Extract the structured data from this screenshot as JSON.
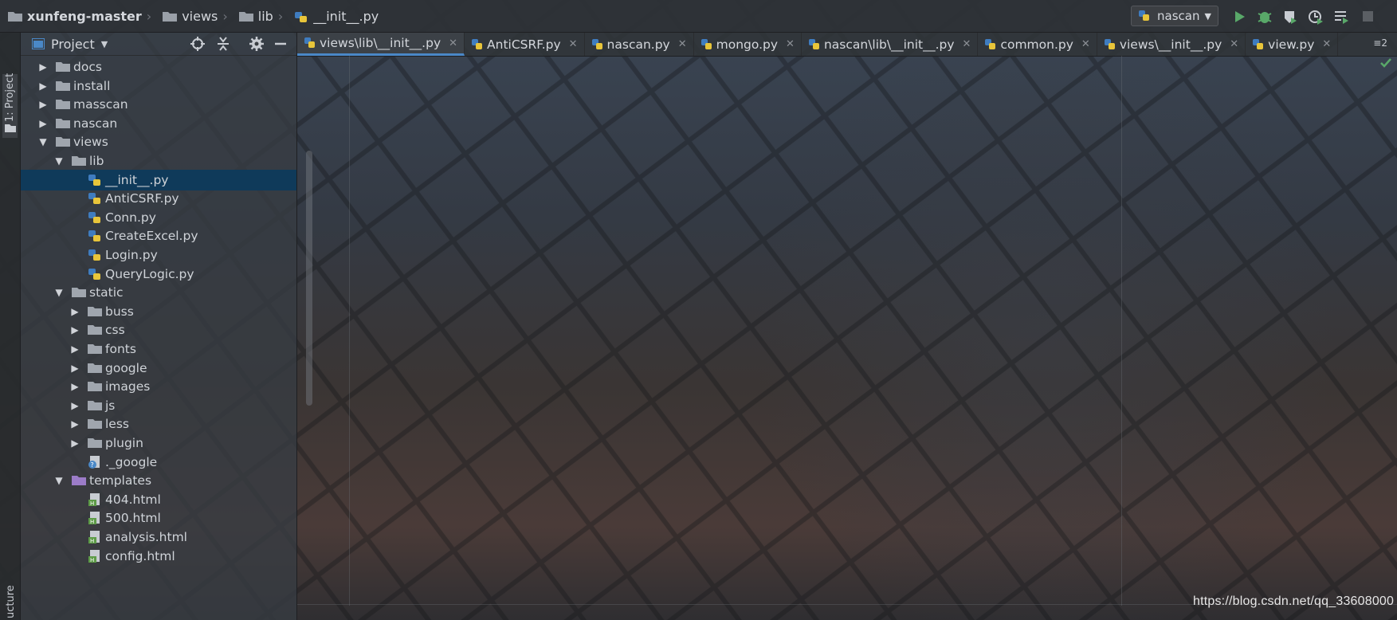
{
  "breadcrumb": {
    "items": [
      "xunfeng-master",
      "views",
      "lib",
      "__init__.py"
    ]
  },
  "run_config": {
    "label": "nascan"
  },
  "toolbar_icons": [
    "run-icon",
    "debug-icon",
    "coverage-icon",
    "profile-icon",
    "run-list-icon",
    "stop-icon"
  ],
  "left_strip": {
    "project_tab": "1: Project",
    "structure_tab": "ucture"
  },
  "project_panel": {
    "title": "Project",
    "tree": [
      {
        "label": "docs",
        "depth": 0,
        "type": "folder",
        "expanded": false
      },
      {
        "label": "install",
        "depth": 0,
        "type": "folder",
        "expanded": false
      },
      {
        "label": "masscan",
        "depth": 0,
        "type": "folder",
        "expanded": false
      },
      {
        "label": "nascan",
        "depth": 0,
        "type": "folder",
        "expanded": false
      },
      {
        "label": "views",
        "depth": 0,
        "type": "folder",
        "expanded": true
      },
      {
        "label": "lib",
        "depth": 1,
        "type": "folder",
        "expanded": true
      },
      {
        "label": "__init__.py",
        "depth": 2,
        "type": "python",
        "selected": true
      },
      {
        "label": "AntiCSRF.py",
        "depth": 2,
        "type": "python"
      },
      {
        "label": "Conn.py",
        "depth": 2,
        "type": "python"
      },
      {
        "label": "CreateExcel.py",
        "depth": 2,
        "type": "python"
      },
      {
        "label": "Login.py",
        "depth": 2,
        "type": "python"
      },
      {
        "label": "QueryLogic.py",
        "depth": 2,
        "type": "python"
      },
      {
        "label": "static",
        "depth": 1,
        "type": "folder",
        "expanded": true
      },
      {
        "label": "buss",
        "depth": 2,
        "type": "folder",
        "expanded": false
      },
      {
        "label": "css",
        "depth": 2,
        "type": "folder",
        "expanded": false
      },
      {
        "label": "fonts",
        "depth": 2,
        "type": "folder",
        "expanded": false
      },
      {
        "label": "google",
        "depth": 2,
        "type": "folder",
        "expanded": false
      },
      {
        "label": "images",
        "depth": 2,
        "type": "folder",
        "expanded": false
      },
      {
        "label": "js",
        "depth": 2,
        "type": "folder",
        "expanded": false
      },
      {
        "label": "less",
        "depth": 2,
        "type": "folder",
        "expanded": false
      },
      {
        "label": "plugin",
        "depth": 2,
        "type": "folder",
        "expanded": false
      },
      {
        "label": "._google",
        "depth": 2,
        "type": "unknown"
      },
      {
        "label": "templates",
        "depth": 1,
        "type": "template-folder",
        "expanded": true
      },
      {
        "label": "404.html",
        "depth": 2,
        "type": "html"
      },
      {
        "label": "500.html",
        "depth": 2,
        "type": "html"
      },
      {
        "label": "analysis.html",
        "depth": 2,
        "type": "html"
      },
      {
        "label": "config.html",
        "depth": 2,
        "type": "html"
      }
    ]
  },
  "editor_tabs": [
    {
      "label": "views\\lib\\__init__.py",
      "active": true
    },
    {
      "label": "AntiCSRF.py"
    },
    {
      "label": "nascan.py"
    },
    {
      "label": "mongo.py"
    },
    {
      "label": "nascan\\lib\\__init__.py"
    },
    {
      "label": "common.py"
    },
    {
      "label": "views\\__init__.py"
    },
    {
      "label": "view.py"
    }
  ],
  "tabs_overflow": "≡2",
  "watermark": "https://blog.csdn.net/qq_33608000",
  "colors": {
    "selection": "#0f3a5a",
    "accent": "#4a88c7",
    "run_green": "#59a869",
    "python_blue": "#3f7cbf",
    "python_yellow": "#e8c53a",
    "html_green": "#5d9b47",
    "template_purple": "#9c7cc8"
  }
}
